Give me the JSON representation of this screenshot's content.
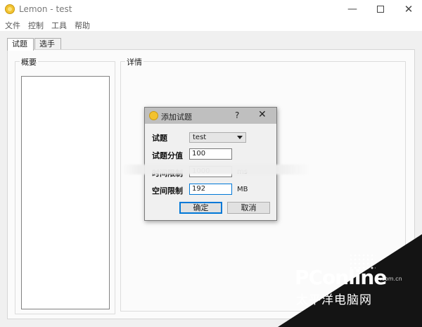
{
  "window": {
    "title": "Lemon - test",
    "icon": "lemon-icon",
    "controls": {
      "minimize": "—",
      "close": "✕"
    }
  },
  "menu": [
    "文件",
    "控制",
    "工具",
    "帮助"
  ],
  "tabs": [
    {
      "label": "试题",
      "active": true
    },
    {
      "label": "选手",
      "active": false
    }
  ],
  "panels": {
    "overview_title": "概要",
    "details_title": "详情"
  },
  "dialog": {
    "title": "添加试题",
    "help": "?",
    "close": "✕",
    "fields": {
      "task": {
        "label": "试题",
        "value": "test"
      },
      "score": {
        "label": "试题分值",
        "value": "100"
      },
      "time": {
        "label": "时间限制",
        "value": "1000",
        "unit": "ms"
      },
      "memory": {
        "label": "空间限制",
        "value": "192",
        "unit": "MB"
      }
    },
    "ok_label": "确定",
    "cancel_label": "取消"
  },
  "watermark": {
    "logo": "PConline",
    "domain": ".com.cn",
    "tagline": "太平洋电脑网"
  },
  "colors": {
    "focus_accent": "#0078d7",
    "dialog_titlebar": "#bfbfbf",
    "app_icon": "#f2c230"
  }
}
